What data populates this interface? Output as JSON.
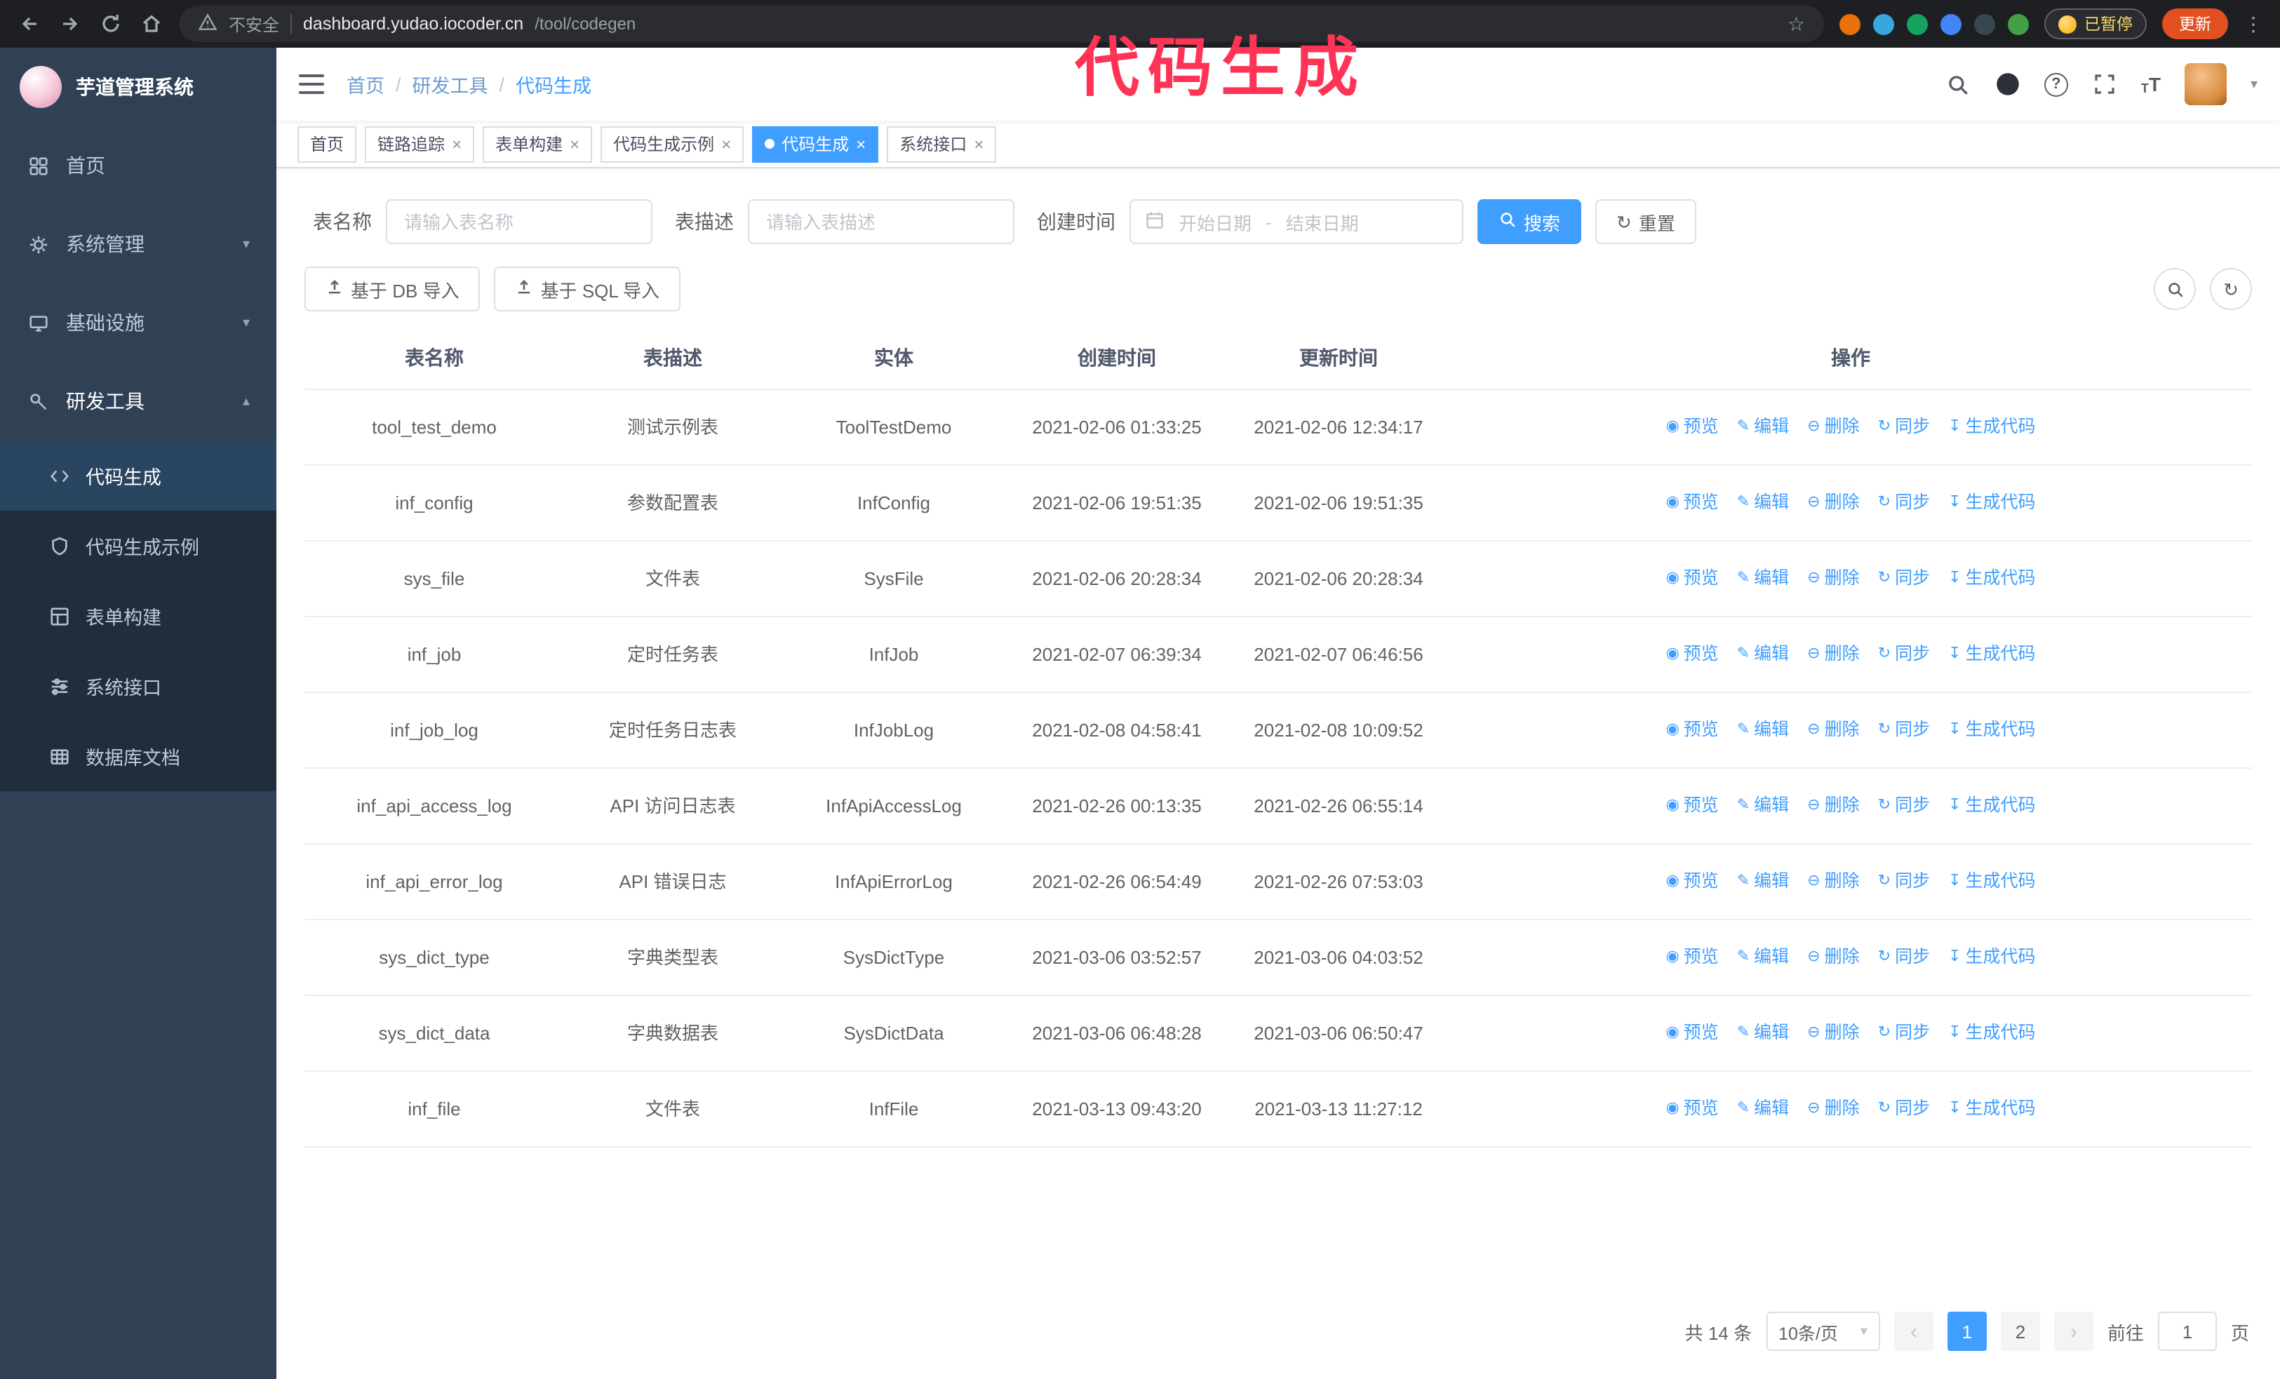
{
  "colors": {
    "accent": "#409eff",
    "annotation": "#ff3355",
    "update_button": "#e25022",
    "sidebar_bg": "#304156",
    "submenu_bg": "#1f2d3d"
  },
  "annotation": {
    "text": "代码生成"
  },
  "browser": {
    "warning_text": "不安全",
    "url_host": "dashboard.yudao.iocoder.cn",
    "url_path": "/tool/codegen",
    "paused_badge": "已暂停",
    "update_label": "更新",
    "extension_colors": [
      "#e8710a",
      "#39a7dd",
      "#16a35f",
      "#4285f4",
      "#37474f",
      "#43a047"
    ]
  },
  "sidebar": {
    "logo_title": "芋道管理系统",
    "menu": [
      {
        "label": "首页"
      },
      {
        "label": "系统管理"
      },
      {
        "label": "基础设施"
      },
      {
        "label": "研发工具"
      }
    ],
    "submenu": [
      {
        "label": "代码生成"
      },
      {
        "label": "代码生成示例"
      },
      {
        "label": "表单构建"
      },
      {
        "label": "系统接口"
      },
      {
        "label": "数据库文档"
      }
    ]
  },
  "navbar": {
    "separator": "/",
    "breadcrumb": [
      {
        "label": "首页"
      },
      {
        "label": "研发工具"
      },
      {
        "label": "代码生成"
      }
    ]
  },
  "tabs": [
    {
      "label": "首页"
    },
    {
      "label": "链路追踪"
    },
    {
      "label": "表单构建"
    },
    {
      "label": "代码生成示例"
    },
    {
      "label": "代码生成"
    },
    {
      "label": "系统接口"
    }
  ],
  "filters": {
    "table_name_label": "表名称",
    "table_name_placeholder": "请输入表名称",
    "table_desc_label": "表描述",
    "table_desc_placeholder": "请输入表描述",
    "create_time_label": "创建时间",
    "date_start_placeholder": "开始日期",
    "date_separator": "-",
    "date_end_placeholder": "结束日期",
    "search_label": "搜索",
    "reset_label": "重置"
  },
  "toolbar": {
    "import_db_label": "基于 DB 导入",
    "import_sql_label": "基于 SQL 导入"
  },
  "table": {
    "columns": [
      "表名称",
      "表描述",
      "实体",
      "创建时间",
      "更新时间",
      "操作"
    ],
    "actions": [
      {
        "name": "preview",
        "label": "预览",
        "icon": "eye-icon"
      },
      {
        "name": "edit",
        "label": "编辑",
        "icon": "edit-icon"
      },
      {
        "name": "delete",
        "label": "删除",
        "icon": "delete-icon"
      },
      {
        "name": "sync",
        "label": "同步",
        "icon": "sync-icon"
      },
      {
        "name": "generate",
        "label": "生成代码",
        "icon": "download-icon"
      }
    ],
    "rows": [
      {
        "name": "tool_test_demo",
        "desc": "测试示例表",
        "entity": "ToolTestDemo",
        "created": "2021-02-06 01:33:25",
        "updated": "2021-02-06 12:34:17"
      },
      {
        "name": "inf_config",
        "desc": "参数配置表",
        "entity": "InfConfig",
        "created": "2021-02-06 19:51:35",
        "updated": "2021-02-06 19:51:35"
      },
      {
        "name": "sys_file",
        "desc": "文件表",
        "entity": "SysFile",
        "created": "2021-02-06 20:28:34",
        "updated": "2021-02-06 20:28:34"
      },
      {
        "name": "inf_job",
        "desc": "定时任务表",
        "entity": "InfJob",
        "created": "2021-02-07 06:39:34",
        "updated": "2021-02-07 06:46:56"
      },
      {
        "name": "inf_job_log",
        "desc": "定时任务日志表",
        "entity": "InfJobLog",
        "created": "2021-02-08 04:58:41",
        "updated": "2021-02-08 10:09:52"
      },
      {
        "name": "inf_api_access_log",
        "desc": "API 访问日志表",
        "entity": "InfApiAccessLog",
        "created": "2021-02-26 00:13:35",
        "updated": "2021-02-26 06:55:14"
      },
      {
        "name": "inf_api_error_log",
        "desc": "API 错误日志",
        "entity": "InfApiErrorLog",
        "created": "2021-02-26 06:54:49",
        "updated": "2021-02-26 07:53:03"
      },
      {
        "name": "sys_dict_type",
        "desc": "字典类型表",
        "entity": "SysDictType",
        "created": "2021-03-06 03:52:57",
        "updated": "2021-03-06 04:03:52"
      },
      {
        "name": "sys_dict_data",
        "desc": "字典数据表",
        "entity": "SysDictData",
        "created": "2021-03-06 06:48:28",
        "updated": "2021-03-06 06:50:47"
      },
      {
        "name": "inf_file",
        "desc": "文件表",
        "entity": "InfFile",
        "created": "2021-03-13 09:43:20",
        "updated": "2021-03-13 11:27:12"
      }
    ]
  },
  "pagination": {
    "total_label": "共 14 条",
    "page_size_label": "10条/页",
    "pages": [
      "1",
      "2"
    ],
    "goto_label": "前往",
    "goto_value": "1",
    "page_unit_label": "页"
  }
}
